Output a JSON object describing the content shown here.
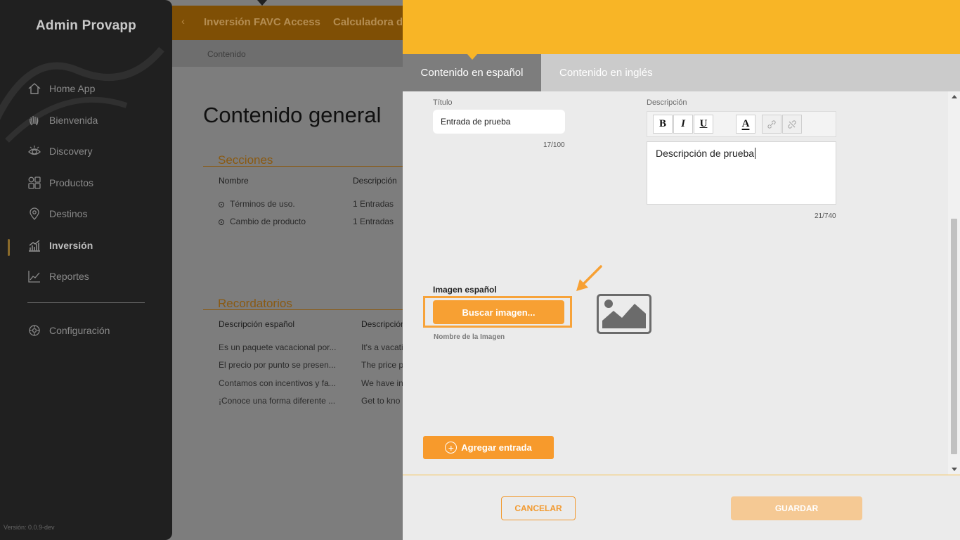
{
  "sidebar": {
    "app_title": "Admin Provapp",
    "items": [
      {
        "label": "Home App",
        "icon": "home-icon"
      },
      {
        "label": "Bienvenida",
        "icon": "wave-hand-icon"
      },
      {
        "label": "Discovery",
        "icon": "eye-icon"
      },
      {
        "label": "Productos",
        "icon": "grid-icon"
      },
      {
        "label": "Destinos",
        "icon": "location-pin-icon"
      },
      {
        "label": "Inversión",
        "icon": "bar-chart-icon",
        "active": true
      },
      {
        "label": "Reportes",
        "icon": "line-chart-icon"
      },
      {
        "label": "Configuración",
        "icon": "gear-icon"
      }
    ],
    "version": "Versión: 0.0.9-dev"
  },
  "background": {
    "tabs": [
      "Inversión FAVC Access",
      "Calculadora de"
    ],
    "breadcrumb": "Contenido",
    "page_title": "Contenido general",
    "sections_title": "Secciones",
    "sections_headers": [
      "Nombre",
      "Descripción"
    ],
    "sections_rows": [
      {
        "name": "Términos de uso.",
        "desc": "1 Entradas"
      },
      {
        "name": "Cambio de producto",
        "desc": "1 Entradas"
      }
    ],
    "reminders_title": "Recordatorios",
    "reminders_headers": [
      "Descripción español",
      "Descripción"
    ],
    "reminders_rows": [
      {
        "es": "Es un paquete vacacional por...",
        "en": "It's a vacati"
      },
      {
        "es": "El precio por punto se presen...",
        "en": "The price p"
      },
      {
        "es": "Contamos con incentivos y fa...",
        "en": "We have in"
      },
      {
        "es": "¡Conoce una forma diferente ...",
        "en": "Get to kno"
      }
    ]
  },
  "panel": {
    "tab_es": "Contenido en español",
    "tab_en": "Contenido en inglés",
    "title_label": "Título",
    "title_value": "Entrada de prueba",
    "title_counter": "17/100",
    "desc_label": "Descripción",
    "toolbar": {
      "bold": "B",
      "italic": "I",
      "underline": "U",
      "color": "A"
    },
    "desc_value": "Descripción de prueba",
    "desc_counter": "21/740",
    "image_label": "Imagen español",
    "search_button": "Buscar imagen...",
    "image_name_label": "Nombre de la Imagen",
    "add_entry": "Agregar entrada",
    "cancel": "CANCELAR",
    "save": "GUARDAR"
  },
  "colors": {
    "accent": "#f8b526",
    "button_orange": "#f7a033",
    "sidebar_bg": "#202020"
  }
}
